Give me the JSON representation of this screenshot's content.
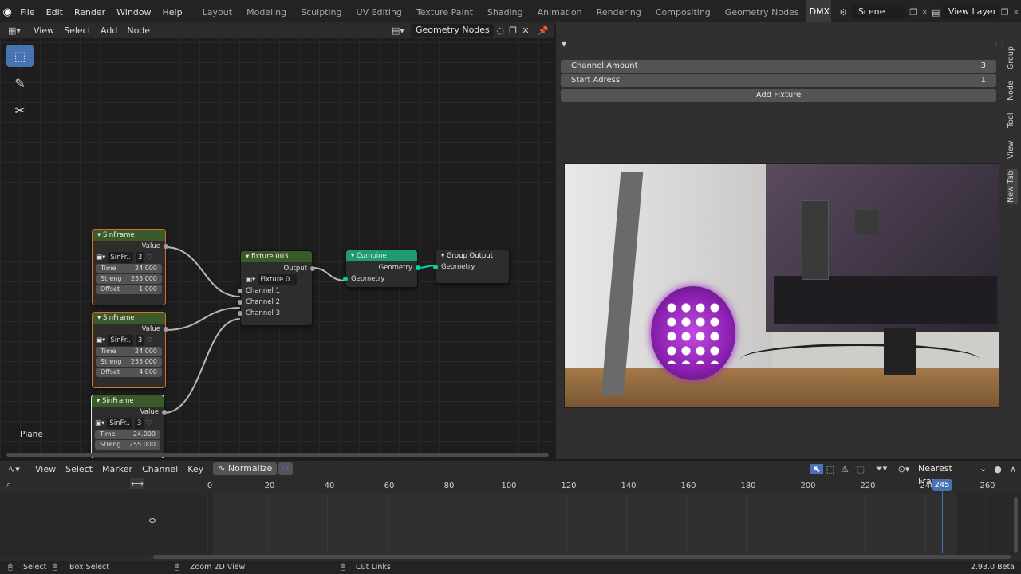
{
  "topbar": {
    "menus": [
      "File",
      "Edit",
      "Render",
      "Window",
      "Help"
    ],
    "workspaces": [
      "Layout",
      "Modeling",
      "Sculpting",
      "UV Editing",
      "Texture Paint",
      "Shading",
      "Animation",
      "Rendering",
      "Compositing",
      "Geometry Nodes",
      "DMX Co"
    ],
    "scene": "Scene",
    "view_layer": "View Layer"
  },
  "node_editor": {
    "menus": [
      "View",
      "Select",
      "Add",
      "Node"
    ],
    "tree_name": "Geometry Nodes",
    "object_label": "Plane",
    "nodes": {
      "sin1": {
        "title": "SinFrame",
        "out": "Value",
        "sel": "SinFr..",
        "num": "3",
        "fields": [
          [
            "Time",
            "24.000"
          ],
          [
            "Streng",
            "255.000"
          ],
          [
            "Offset",
            "1.000"
          ]
        ]
      },
      "sin2": {
        "title": "SinFrame",
        "out": "Value",
        "sel": "SinFr..",
        "num": "3",
        "fields": [
          [
            "Time",
            "24.000"
          ],
          [
            "Streng",
            "255.000"
          ],
          [
            "Offset",
            "4.000"
          ]
        ]
      },
      "sin3": {
        "title": "SinFrame",
        "out": "Value",
        "sel": "SinFr..",
        "num": "3",
        "fields": [
          [
            "Time",
            "24.000"
          ],
          [
            "Streng",
            "255.000"
          ]
        ]
      },
      "fixture": {
        "title": "fixture.003",
        "out": "Output",
        "sel": "Fixture.0..",
        "inputs": [
          "Channel 1",
          "Channel 2",
          "Channel 3"
        ]
      },
      "combine": {
        "title": "Combine",
        "out": "Geometry",
        "in": "Geometry"
      },
      "group_output": {
        "title": "Group Output",
        "in": "Geometry"
      }
    }
  },
  "sidepanel": {
    "channel_amount_label": "Channel Amount",
    "channel_amount": "3",
    "start_address_label": "Start Adress",
    "start_address": "1",
    "add_fixture": "Add Fixture",
    "tabs": [
      "Group",
      "Node",
      "Tool",
      "View",
      "New Tab"
    ]
  },
  "timeline": {
    "menus": [
      "View",
      "Select",
      "Marker",
      "Channel",
      "Key"
    ],
    "normalize": "Normalize",
    "interp": "Nearest Frame",
    "ruler": [
      "0",
      "20",
      "40",
      "60",
      "80",
      "100",
      "120",
      "140",
      "160",
      "180",
      "200",
      "220",
      "240",
      "260"
    ],
    "current_frame": "245"
  },
  "status": {
    "select": "Select",
    "box_select": "Box Select",
    "zoom": "Zoom 2D View",
    "cut_links": "Cut Links",
    "version": "2.93.0 Beta"
  },
  "colors": {
    "accent": "#4772b3",
    "geometry_header": "#1f9b74",
    "group_header": "#4d4d4d",
    "fixture_header": "#3b5a2a"
  }
}
